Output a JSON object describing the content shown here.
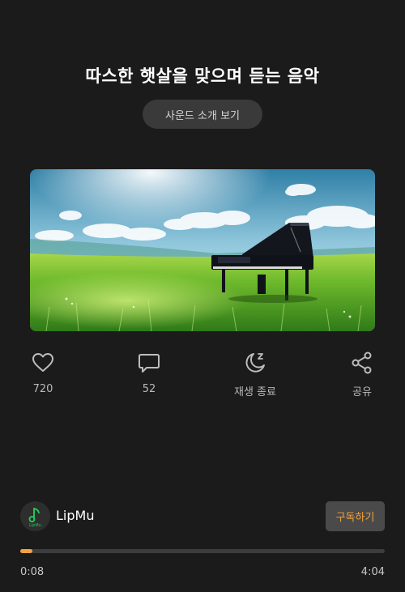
{
  "header": {
    "title": "따스한 햇살을 맞으며 듣는 음악",
    "intro_button_label": "사운드 소개 보기"
  },
  "artwork": {
    "description_icon": "piano-field-artwork"
  },
  "actions": {
    "like": {
      "icon": "heart-icon",
      "label": "720"
    },
    "comment": {
      "icon": "comment-icon",
      "label": "52"
    },
    "sleep_timer": {
      "icon": "moon-icon",
      "label": "재생 종료"
    },
    "share": {
      "icon": "share-icon",
      "label": "공유"
    }
  },
  "channel": {
    "name": "LipMu",
    "avatar_text": "LipMu",
    "subscribe_label": "구독하기"
  },
  "player": {
    "elapsed": "0:08",
    "total": "4:04",
    "progress_fraction": 0.033
  },
  "colors": {
    "background": "#1b1b1b",
    "accent": "#f5a040",
    "subscribe_text": "#f2a13a"
  }
}
